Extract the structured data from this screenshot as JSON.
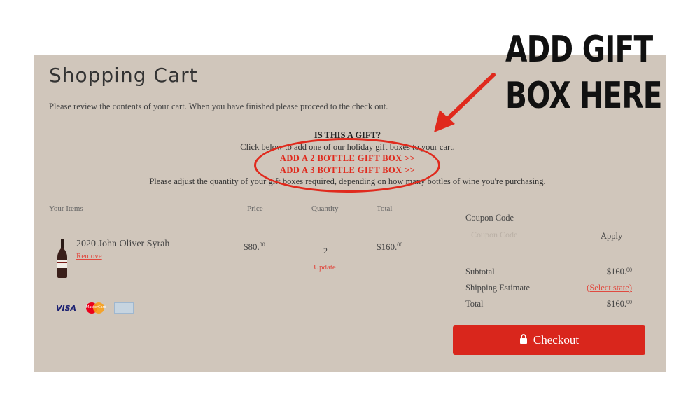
{
  "page": {
    "title": "Shopping Cart",
    "intro": "Please review the contents of your cart. When you have finished please proceed to the check out."
  },
  "gift": {
    "heading": "IS THIS A GIFT?",
    "line1": "Click below to add one of our holiday gift boxes to your cart.",
    "option2": "ADD A 2 BOTTLE GIFT BOX >>",
    "option3": "ADD A 3 BOTTLE GIFT BOX >>",
    "note": "Please adjust the quantity of your gift boxes required, depending on how many bottles of wine you're purchasing."
  },
  "table": {
    "col_items": "Your Items",
    "col_price": "Price",
    "col_qty": "Quantity",
    "col_total": "Total"
  },
  "item": {
    "name": "2020 John Oliver Syrah",
    "remove": "Remove",
    "price_main": "$80.",
    "price_cents": "00",
    "qty": "2",
    "update": "Update",
    "total_main": "$160.",
    "total_cents": "00"
  },
  "payment_icons": [
    "visa-icon",
    "mastercard-icon",
    "amex-icon"
  ],
  "cards": {
    "visa": "VISA",
    "mastercard": "MasterCard"
  },
  "summary": {
    "coupon_label": "Coupon Code",
    "coupon_placeholder": "Coupon Code",
    "apply": "Apply",
    "subtotal_label": "Subtotal",
    "subtotal_main": "$160.",
    "subtotal_cents": "00",
    "shipping_label": "Shipping Estimate",
    "shipping_value": "(Select state)",
    "total_label": "Total",
    "total_main": "$160.",
    "total_cents": "00",
    "checkout": "Checkout"
  },
  "annotation": {
    "line1": "ADD GIFT",
    "line2": "BOX HERE"
  },
  "colors": {
    "panel_bg": "#d0c6bb",
    "accent_red": "#d9261c",
    "link_red": "#e04a40",
    "annotation_red": "#e02a1d"
  }
}
